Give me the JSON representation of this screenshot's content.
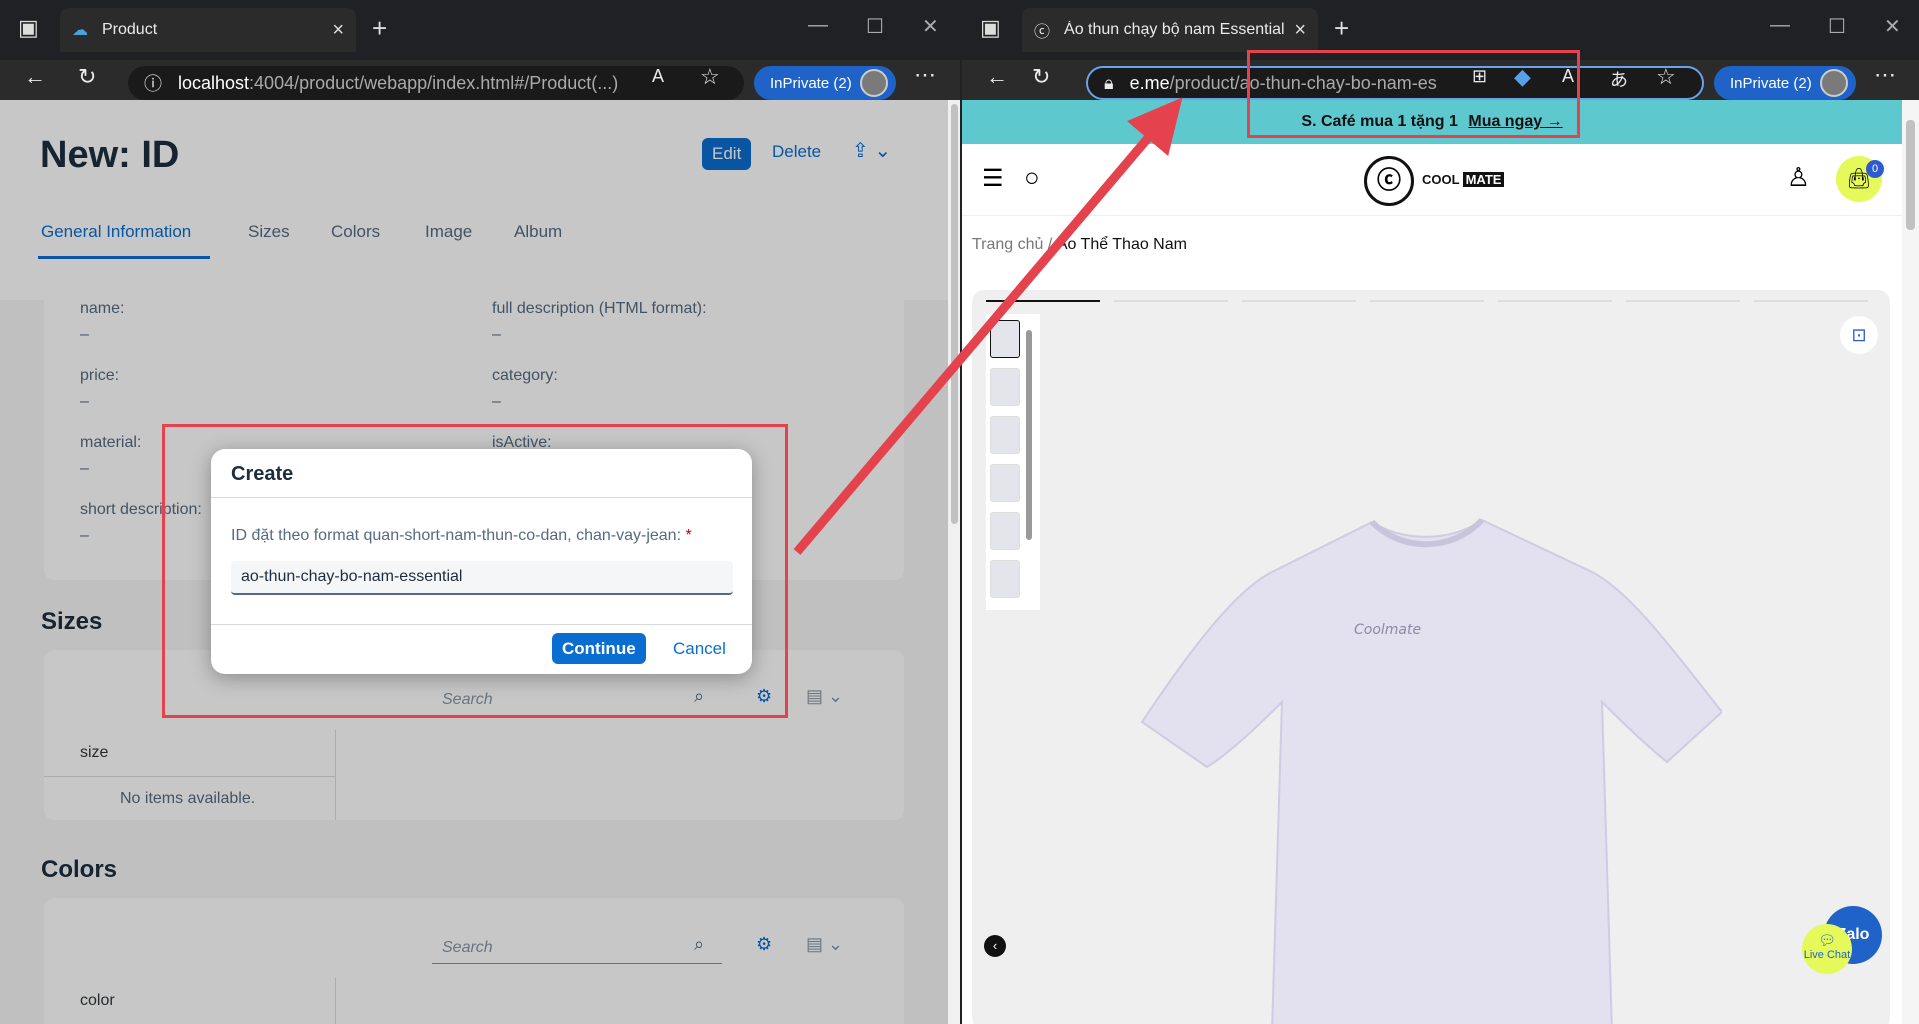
{
  "left_window": {
    "tab_title": "Product",
    "url_host": "localhost",
    "url_rest": ":4004/product/webapp/index.html#/Product(...)",
    "inprivate_label": "InPrivate (2)"
  },
  "app": {
    "page_title": "New: ID",
    "edit_label": "Edit",
    "delete_label": "Delete",
    "tabs": [
      "General Information",
      "Sizes",
      "Colors",
      "Image",
      "Album"
    ],
    "fields": [
      {
        "label": "name:",
        "value": "–"
      },
      {
        "label": "full description (HTML format):",
        "value": "–"
      },
      {
        "label": "price:",
        "value": "–"
      },
      {
        "label": "category:",
        "value": "–"
      },
      {
        "label": "material:",
        "value": "–"
      },
      {
        "label": "isActive:",
        "value": "–"
      },
      {
        "label": "short description:",
        "value": "–"
      }
    ],
    "sizes_title": "Sizes",
    "colors_title": "Colors",
    "search_placeholder": "Search",
    "size_col": "size",
    "color_col": "color",
    "no_items": "No items available."
  },
  "dialog": {
    "title": "Create",
    "label": "ID đặt theo format quan-short-nam-thun-co-dan, chan-vay-jean:",
    "required_mark": "*",
    "input_value": "ao-thun-chay-bo-nam-essential",
    "continue_label": "Continue",
    "cancel_label": "Cancel"
  },
  "right_window": {
    "tab_title": "Áo thun chạy bộ nam Essential F",
    "url_host": "e.me",
    "url_rest": "/product/ao-thun-chay-bo-nam-es",
    "inprivate_label": "InPrivate (2)"
  },
  "shop": {
    "promo_text": "S. Café mua 1 tặng 1",
    "promo_link": "Mua ngay →",
    "logo_cool": "COOL",
    "logo_mate": "MATE",
    "logo_glyph": "ⓒ",
    "cart_count": "0",
    "crumb_home": "Trang chủ",
    "crumb_sep": "/",
    "crumb_current": "Áo Thể Thao Nam",
    "shirt_brand": "Coolmate",
    "zalo_label": "Zalo",
    "live_chat_label": "Live Chat"
  },
  "colors": {
    "sap_blue": "#0a6ed1",
    "edge_inprivate": "#1f63c9",
    "promo_bg": "#5ec8cf",
    "annotation_red": "#e4424d",
    "cart_yellow": "#e5f95a"
  }
}
